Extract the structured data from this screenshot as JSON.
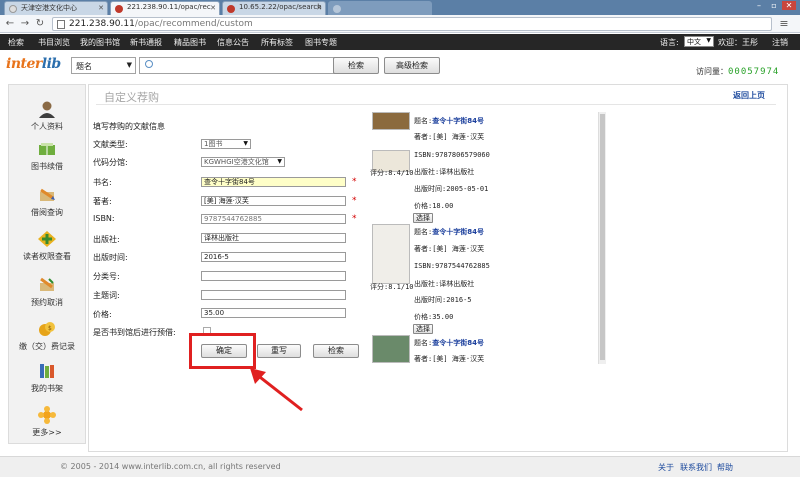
{
  "browser": {
    "tabs": [
      {
        "label": "天津空港文化中心",
        "active": false
      },
      {
        "label": "221.238.90.11/opac/rec",
        "active": true
      },
      {
        "label": "10.65.2.22/opac/search",
        "active": false
      },
      {
        "label": "",
        "active": false
      }
    ],
    "url_host": "221.238.90.11",
    "url_path": "/opac/recommend/custom"
  },
  "topnav": {
    "items": [
      "检索",
      "书目浏览",
      "我的图书馆",
      "新书通报",
      "精品图书",
      "信息公告",
      "所有标签",
      "图书专题"
    ],
    "language_label": "语言:",
    "language_value": "中文",
    "welcome": "欢迎：王彤",
    "logout": "注销"
  },
  "header": {
    "logo_part1": "inter",
    "logo_part2": "lib",
    "search_field": "题名",
    "search_placeholder": "",
    "search_button": "检索",
    "advanced_button": "高级检索",
    "visits_label": "访问量：",
    "visits_value": "00057974"
  },
  "sidebar": {
    "items": [
      {
        "label": "个人资料",
        "icon": "user-icon"
      },
      {
        "label": "图书续借",
        "icon": "book-renew-icon"
      },
      {
        "label": "借阅查询",
        "icon": "borrow-query-icon"
      },
      {
        "label": "读者权限查看",
        "icon": "permission-icon"
      },
      {
        "label": "预约取消",
        "icon": "reserve-cancel-icon"
      },
      {
        "label": "缴（交）费记录",
        "icon": "fee-icon"
      },
      {
        "label": "我的书架",
        "icon": "bookshelf-icon"
      },
      {
        "label": "更多>>",
        "icon": "more-icon"
      }
    ]
  },
  "main": {
    "title": "自定义荐购",
    "back_link": "返回上页",
    "section_label": "填写荐购的文献信息",
    "fields": {
      "doc_type_label": "文献类型:",
      "doc_type_value": "1图书",
      "code_label": "代码分馆:",
      "code_value": "KGWHGI空港文化馆",
      "title_label": "书名:",
      "title_value": "查令十字街84号",
      "author_label": "著者:",
      "author_value": "[美] 海莲·汉芙",
      "isbn_label": "ISBN:",
      "isbn_value": "9787544762885",
      "publisher_label": "出版社:",
      "publisher_value": "译林出版社",
      "pubdate_label": "出版时间:",
      "pubdate_value": "2016-5",
      "class_label": "分类号:",
      "class_value": "",
      "subject_label": "主题词:",
      "subject_value": "",
      "price_label": "价格:",
      "price_value": "35.00",
      "reserve_label": "是否书到馆后进行预借:"
    },
    "buttons": {
      "confirm": "确定",
      "reset": "重写",
      "search": "检索"
    },
    "required_mark": "*"
  },
  "results": [
    {
      "title_label": "题名:",
      "title": "查令十字街84号",
      "author": "著者:[美] 海莲·汉芙",
      "isbn": "ISBN:9787806579060",
      "rating": "评分:8.4/10",
      "publisher": "出版社:译林出版社",
      "pubdate": "出版时间:2005-05-01",
      "price": "价格:18.00",
      "select": "选择"
    },
    {
      "title_label": "题名:",
      "title": "查令十字街84号",
      "author": "著者:[美] 海莲·汉芙",
      "isbn": "ISBN:9787544762885",
      "rating": "评分:8.1/10",
      "publisher": "出版社:译林出版社",
      "pubdate": "出版时间:2016-5",
      "price": "价格:35.00",
      "select": "选择"
    },
    {
      "title_label": "题名:",
      "title": "查令十字街84号",
      "author": "著者:[美] 海莲·汉芙"
    }
  ],
  "footer": {
    "copyright": "© 2005 - 2014 www.interlib.com.cn, all rights reserved",
    "links": [
      "关于",
      "联系我们",
      "帮助"
    ]
  },
  "colors": {
    "annotation": "#e02020",
    "link": "#1e4b9e",
    "visits": "#2aa22a",
    "topnav": "#262626",
    "highlight_input": "#ffffc8"
  }
}
